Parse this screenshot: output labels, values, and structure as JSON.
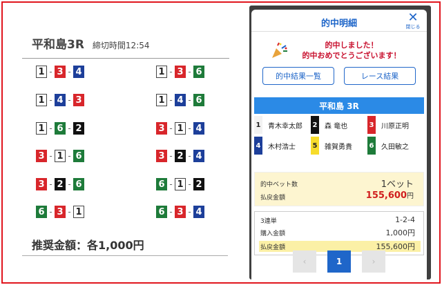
{
  "left": {
    "race_name": "平和島3R",
    "deadline": "締切時間12:54",
    "combos": [
      [
        1,
        3,
        4
      ],
      [
        1,
        3,
        6
      ],
      [
        1,
        4,
        3
      ],
      [
        1,
        4,
        6
      ],
      [
        1,
        6,
        2
      ],
      [
        3,
        1,
        4
      ],
      [
        3,
        1,
        6
      ],
      [
        3,
        2,
        4
      ],
      [
        3,
        2,
        6
      ],
      [
        6,
        1,
        2
      ],
      [
        6,
        3,
        1
      ],
      [
        6,
        3,
        4
      ]
    ],
    "amount": "推奨金額：各1,000円"
  },
  "modal": {
    "title": "的中明細",
    "close_label": "閉じる",
    "close_icon": "close-icon",
    "congrats_line1": "的中しました！",
    "congrats_line2": "的中おめでとうございます！",
    "btn_results_list": "的中結果一覧",
    "btn_race_results": "レース結果",
    "race_bar": "平和島 3R",
    "entries": [
      {
        "num": "1",
        "name": "青木幸太郎"
      },
      {
        "num": "2",
        "name": "森 竜也"
      },
      {
        "num": "3",
        "name": "川原正明"
      },
      {
        "num": "4",
        "name": "木村浩士"
      },
      {
        "num": "5",
        "name": "雑賀勇貴"
      },
      {
        "num": "6",
        "name": "久田敏之"
      }
    ],
    "payout": {
      "hit_bets_label": "的中ベット数",
      "hit_bets_value": "1ベット",
      "refund_label": "払戻金額",
      "refund_value": "155,600",
      "yen": "円"
    },
    "detail": {
      "type_label": "3連単",
      "type_value": "1-2-4",
      "purchase_label": "購入金額",
      "purchase_value": "1,000円",
      "refund_label": "払戻金額",
      "refund_value": "155,600円"
    },
    "pager": {
      "prev": "‹",
      "current": "1",
      "next": "›"
    }
  },
  "colors": {
    "frame": "#e0141c",
    "accent": "#1f66c9",
    "boat1": "#ffffff",
    "boat2": "#111111",
    "boat3": "#d8262b",
    "boat4": "#1d3f9a",
    "boat5": "#f7dc2b",
    "boat6": "#1e7b3a"
  }
}
